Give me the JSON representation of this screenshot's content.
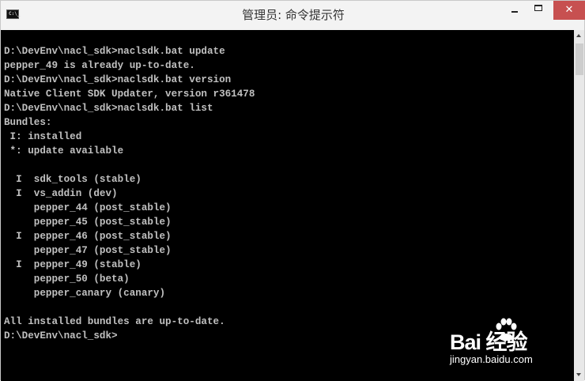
{
  "window": {
    "title": "管理员: 命令提示符",
    "icon_label": "C:\\_"
  },
  "titlebar_buttons": {
    "minimize": "–",
    "maximize": "□",
    "close": "✕"
  },
  "console": {
    "lines": [
      "D:\\DevEnv\\nacl_sdk>naclsdk.bat update",
      "pepper_49 is already up-to-date.",
      "D:\\DevEnv\\nacl_sdk>naclsdk.bat version",
      "Native Client SDK Updater, version r361478",
      "D:\\DevEnv\\nacl_sdk>naclsdk.bat list",
      "Bundles:",
      " I: installed",
      " *: update available",
      "",
      "  I  sdk_tools (stable)",
      "  I  vs_addin (dev)",
      "     pepper_44 (post_stable)",
      "     pepper_45 (post_stable)",
      "  I  pepper_46 (post_stable)",
      "     pepper_47 (post_stable)",
      "  I  pepper_49 (stable)",
      "     pepper_50 (beta)",
      "     pepper_canary (canary)",
      "",
      "All installed bundles are up-to-date.",
      "D:\\DevEnv\\nacl_sdk>"
    ]
  },
  "watermark": {
    "brand": "Bai  经验",
    "url": "jingyan.baidu.com"
  }
}
